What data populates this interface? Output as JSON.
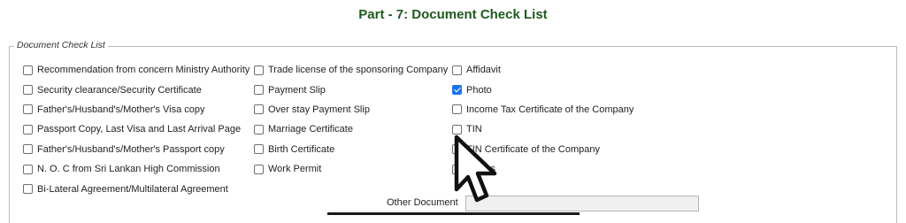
{
  "page": {
    "title": "Part - 7: Document Check List"
  },
  "checklist": {
    "legend": "Document Check List",
    "columns": [
      {
        "items": [
          {
            "label": "Recommendation from concern Ministry Authority",
            "checked": false
          },
          {
            "label": "Security clearance/Security Certificate",
            "checked": false
          },
          {
            "label": "Father's/Husband's/Mother's Visa copy",
            "checked": false
          },
          {
            "label": "Passport Copy, Last Visa and Last Arrival Page",
            "checked": false
          },
          {
            "label": "Father's/Husband's/Mother's Passport copy",
            "checked": false
          },
          {
            "label": "N. O. C from Sri Lankan High Commission",
            "checked": false
          },
          {
            "label": "Bi-Lateral Agreement/Multilateral Agreement",
            "checked": false
          }
        ]
      },
      {
        "items": [
          {
            "label": "Trade license of the sponsoring Company",
            "checked": false
          },
          {
            "label": "Payment Slip",
            "checked": false
          },
          {
            "label": "Over stay Payment Slip",
            "checked": false
          },
          {
            "label": "Marriage Certificate",
            "checked": false
          },
          {
            "label": "Birth Certificate",
            "checked": false
          },
          {
            "label": "Work Permit",
            "checked": false
          }
        ]
      },
      {
        "items": [
          {
            "label": "Affidavit",
            "checked": false
          },
          {
            "label": "Photo",
            "checked": true
          },
          {
            "label": "Income Tax Certificate of the Company",
            "checked": false
          },
          {
            "label": "TIN",
            "checked": false
          },
          {
            "label": "TIN Certificate of the Company",
            "checked": false
          },
          {
            "label": "Others",
            "checked": false
          }
        ]
      }
    ]
  },
  "other_document": {
    "label": "Other Document",
    "value": ""
  },
  "colors": {
    "title": "#1e5a1e",
    "checkbox_checked": "#1a73e8"
  },
  "icons": {
    "cursor": "mouse-pointer-icon"
  }
}
